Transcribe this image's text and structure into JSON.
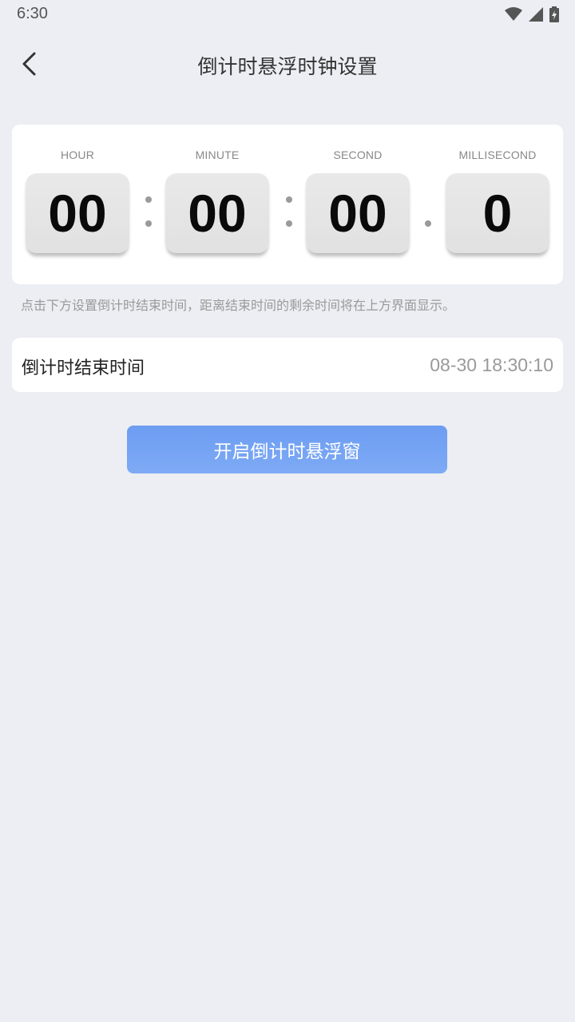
{
  "status_bar": {
    "time": "6:30",
    "icons": [
      "wifi-icon",
      "signal-icon",
      "battery-charging-icon"
    ]
  },
  "header": {
    "title": "倒计时悬浮时钟设置",
    "back_icon": "chevron-left-icon"
  },
  "timer": {
    "units": [
      {
        "label": "HOUR",
        "value": "00"
      },
      {
        "label": "MINUTE",
        "value": "00"
      },
      {
        "label": "SECOND",
        "value": "00"
      },
      {
        "label": "MILLISECOND",
        "value": "0"
      }
    ]
  },
  "hint": "点击下方设置倒计时结束时间，距离结束时间的剩余时间将在上方界面显示。",
  "end_time": {
    "label": "倒计时结束时间",
    "value": "08-30 18:30:10"
  },
  "start_button": {
    "label": "开启倒计时悬浮窗"
  },
  "colors": {
    "background": "#eceef3",
    "card": "#ffffff",
    "accent": "#6d9df2",
    "digit_box": "#e4e4e4"
  }
}
